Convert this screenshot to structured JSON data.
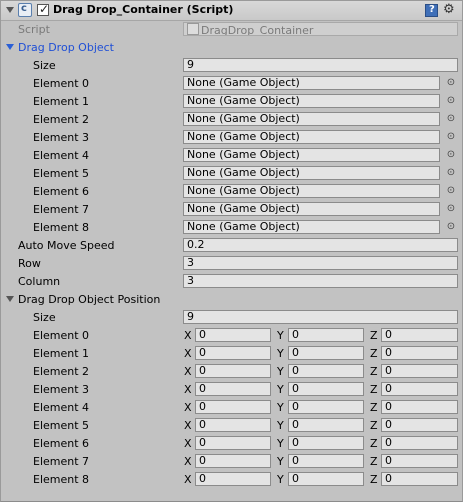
{
  "component": {
    "title": "Drag Drop_Container (Script)",
    "enabled": true,
    "script_label": "Script",
    "script_value": "DragDrop_Container",
    "help_icon": "help-book-icon",
    "settings_icon": "gear-icon"
  },
  "drag_drop_object": {
    "label": "Drag Drop Object",
    "size_label": "Size",
    "size_value": "9",
    "elements": [
      {
        "label": "Element 0",
        "value": "None (Game Object)"
      },
      {
        "label": "Element 1",
        "value": "None (Game Object)"
      },
      {
        "label": "Element 2",
        "value": "None (Game Object)"
      },
      {
        "label": "Element 3",
        "value": "None (Game Object)"
      },
      {
        "label": "Element 4",
        "value": "None (Game Object)"
      },
      {
        "label": "Element 5",
        "value": "None (Game Object)"
      },
      {
        "label": "Element 6",
        "value": "None (Game Object)"
      },
      {
        "label": "Element 7",
        "value": "None (Game Object)"
      },
      {
        "label": "Element 8",
        "value": "None (Game Object)"
      }
    ]
  },
  "fields": {
    "auto_move_speed": {
      "label": "Auto Move Speed",
      "value": "0.2"
    },
    "row": {
      "label": "Row",
      "value": "3"
    },
    "column": {
      "label": "Column",
      "value": "3"
    }
  },
  "drag_drop_object_position": {
    "label": "Drag Drop Object Position",
    "size_label": "Size",
    "size_value": "9",
    "axis_labels": {
      "x": "X",
      "y": "Y",
      "z": "Z"
    },
    "elements": [
      {
        "label": "Element 0",
        "x": "0",
        "y": "0",
        "z": "0"
      },
      {
        "label": "Element 1",
        "x": "0",
        "y": "0",
        "z": "0"
      },
      {
        "label": "Element 2",
        "x": "0",
        "y": "0",
        "z": "0"
      },
      {
        "label": "Element 3",
        "x": "0",
        "y": "0",
        "z": "0"
      },
      {
        "label": "Element 4",
        "x": "0",
        "y": "0",
        "z": "0"
      },
      {
        "label": "Element 5",
        "x": "0",
        "y": "0",
        "z": "0"
      },
      {
        "label": "Element 6",
        "x": "0",
        "y": "0",
        "z": "0"
      },
      {
        "label": "Element 7",
        "x": "0",
        "y": "0",
        "z": "0"
      },
      {
        "label": "Element 8",
        "x": "0",
        "y": "0",
        "z": "0"
      }
    ]
  },
  "colors": {
    "background": "#c2c2c2",
    "field": "#e4e4e4",
    "highlight_blue": "#1f4fd6"
  }
}
